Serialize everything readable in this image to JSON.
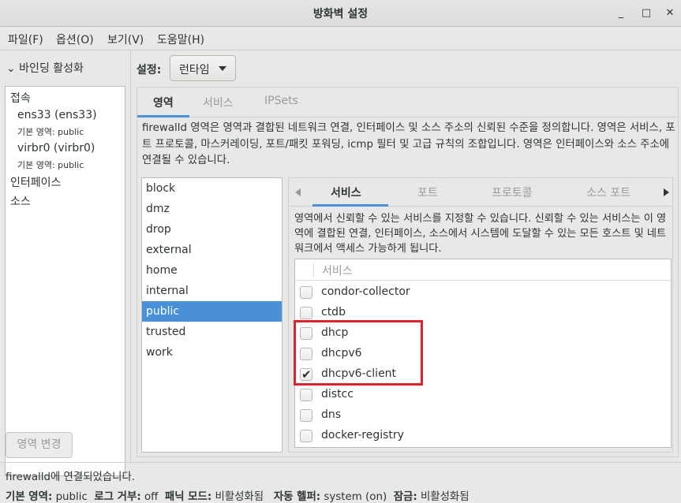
{
  "window": {
    "title": "방화벽 설정",
    "minimize_glyph": "_",
    "maximize_glyph": "□",
    "close_glyph": "✕"
  },
  "menubar": [
    "파일(F)",
    "옵션(O)",
    "보기(V)",
    "도움말(H)"
  ],
  "left": {
    "binding_toggle": "⌄  바인딩 활성화",
    "connections_header": "접속",
    "connections": [
      {
        "name": "ens33 (ens33)",
        "zone": "기본 영역: public"
      },
      {
        "name": "virbr0 (virbr0)",
        "zone": "기본 영역: public"
      }
    ],
    "interfaces_header": "인터페이스",
    "sources_header": "소스",
    "change_zone_button": "영역 변경"
  },
  "config": {
    "label": "설정:",
    "mode": "런타임"
  },
  "main_tabs": [
    "영역",
    "서비스",
    "IPSets"
  ],
  "zone_description": "firewalld 영역은 영역과 결합된 네트워크 연결, 인터페이스 및 소스 주소의 신뢰된 수준을 정의합니다. 영역은 서비스, 포트 프로토콜, 마스커레이딩, 포트/패킷 포워딩, icmp 필터 및 고급 규칙의 조합입니다. 영역은 인터페이스와 소스 주소에 연결될 수 있습니다.",
  "zones": [
    "block",
    "dmz",
    "drop",
    "external",
    "home",
    "internal",
    "public",
    "trusted",
    "work"
  ],
  "selected_zone": "public",
  "sub_tabs": [
    "서비스",
    "포트",
    "프로토콜",
    "소스 포트"
  ],
  "services_description": "영역에서 신뢰할 수 있는 서비스를 지정할 수 있습니다. 신뢰할 수 있는 서비스는 이 영역에 결합된 연결, 인터페이스, 소스에서 시스템에 도달할 수 있는 모든 호스트 및 네트워크에서 액세스 가능하게 됩니다.",
  "services_column": "서비스",
  "services": [
    {
      "name": "condor-collector",
      "checked": false
    },
    {
      "name": "ctdb",
      "checked": false
    },
    {
      "name": "dhcp",
      "checked": false
    },
    {
      "name": "dhcpv6",
      "checked": false
    },
    {
      "name": "dhcpv6-client",
      "checked": true
    },
    {
      "name": "distcc",
      "checked": false
    },
    {
      "name": "dns",
      "checked": false
    },
    {
      "name": "docker-registry",
      "checked": false
    }
  ],
  "status": {
    "message": "firewalld에 연결되었습니다.",
    "default_zone_label": "기본 영역:",
    "default_zone": "public",
    "log_denied_label": "로그 거부:",
    "log_denied": "off",
    "panic_label": "패닉 모드:",
    "panic": "비활성화됨",
    "helper_label": "자동 헬퍼:",
    "helper": "system (on)",
    "lockdown_label": "잠금:",
    "lockdown": "비활성화됨"
  },
  "colors": {
    "accent": "#4a90d9",
    "highlight_box": "#d9232d"
  }
}
